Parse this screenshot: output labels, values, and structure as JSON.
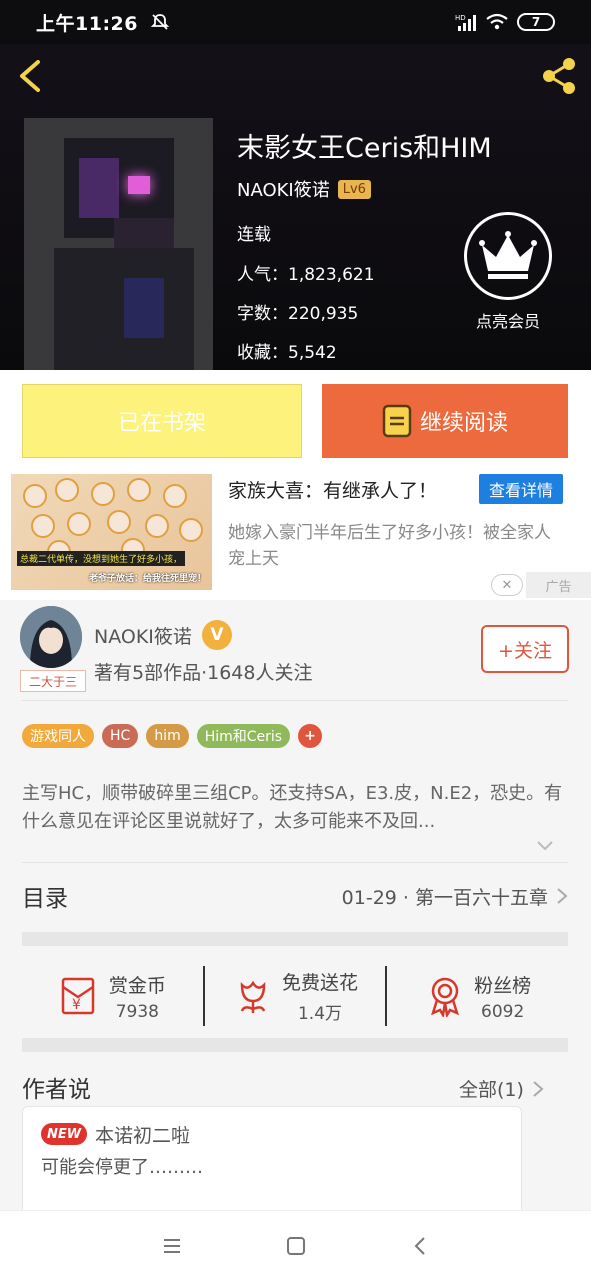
{
  "status_bar": {
    "time": "上午11:26",
    "battery": "7",
    "network": "HD"
  },
  "header": {
    "title": "末影女王Ceris和HIM",
    "author": "NAOKI筱诺",
    "level": "Lv6",
    "status": "连载",
    "popularity": "人气：1,823,621",
    "word_count": "字数：220,935",
    "favorites": "收藏：5,542",
    "vip_label": "点亮会员"
  },
  "actions": {
    "shelf_label": "已在书架",
    "read_label": "继续阅读"
  },
  "ad": {
    "title": "家族大喜：有继承人了！",
    "button": "查看详情",
    "desc": "她嫁入豪门半年后生了好多小孩！被全家人宠上天",
    "img_caption1": "总裁二代单传，没想到她生了好多小孩，",
    "img_caption2": "老爷子放话：给我往死里宠！",
    "close": "✕",
    "tag": "广告"
  },
  "author": {
    "name": "NAOKI筱诺",
    "verified": "V",
    "stats": "著有5部作品·1648人关注",
    "follow": "+关注",
    "avatar_tag": "二大于三"
  },
  "tags": [
    {
      "label": "游戏同人",
      "color": "#f0a93a"
    },
    {
      "label": "HC",
      "color": "#c96b57"
    },
    {
      "label": "him",
      "color": "#d49a45"
    },
    {
      "label": "Him和Ceris",
      "color": "#8fb95a"
    },
    {
      "label": "+",
      "color": "#e0553d"
    }
  ],
  "intro": "主写HC，顺带破碎里三组CP。还支持SA，E3.皮，N.E2，恐史。有什么意见在评论区里说就好了，太多可能来不及回...",
  "toc": {
    "title": "目录",
    "latest": "01-29 · 第一百六十五章"
  },
  "stats": [
    {
      "label": "赏金币",
      "value": "7938",
      "icon": "money-envelope-icon"
    },
    {
      "label": "免费送花",
      "value": "1.4万",
      "icon": "flower-icon"
    },
    {
      "label": "粉丝榜",
      "value": "6092",
      "icon": "medal-icon"
    }
  ],
  "author_says": {
    "title": "作者说",
    "all": "全部(1)",
    "badge": "NEW",
    "note_title": "本诺初二啦",
    "note_body": "可能会停更了………"
  },
  "colors": {
    "accent": "#ed6a3f",
    "shelf": "#fdf27c",
    "ad_button": "#1d7fe0"
  }
}
